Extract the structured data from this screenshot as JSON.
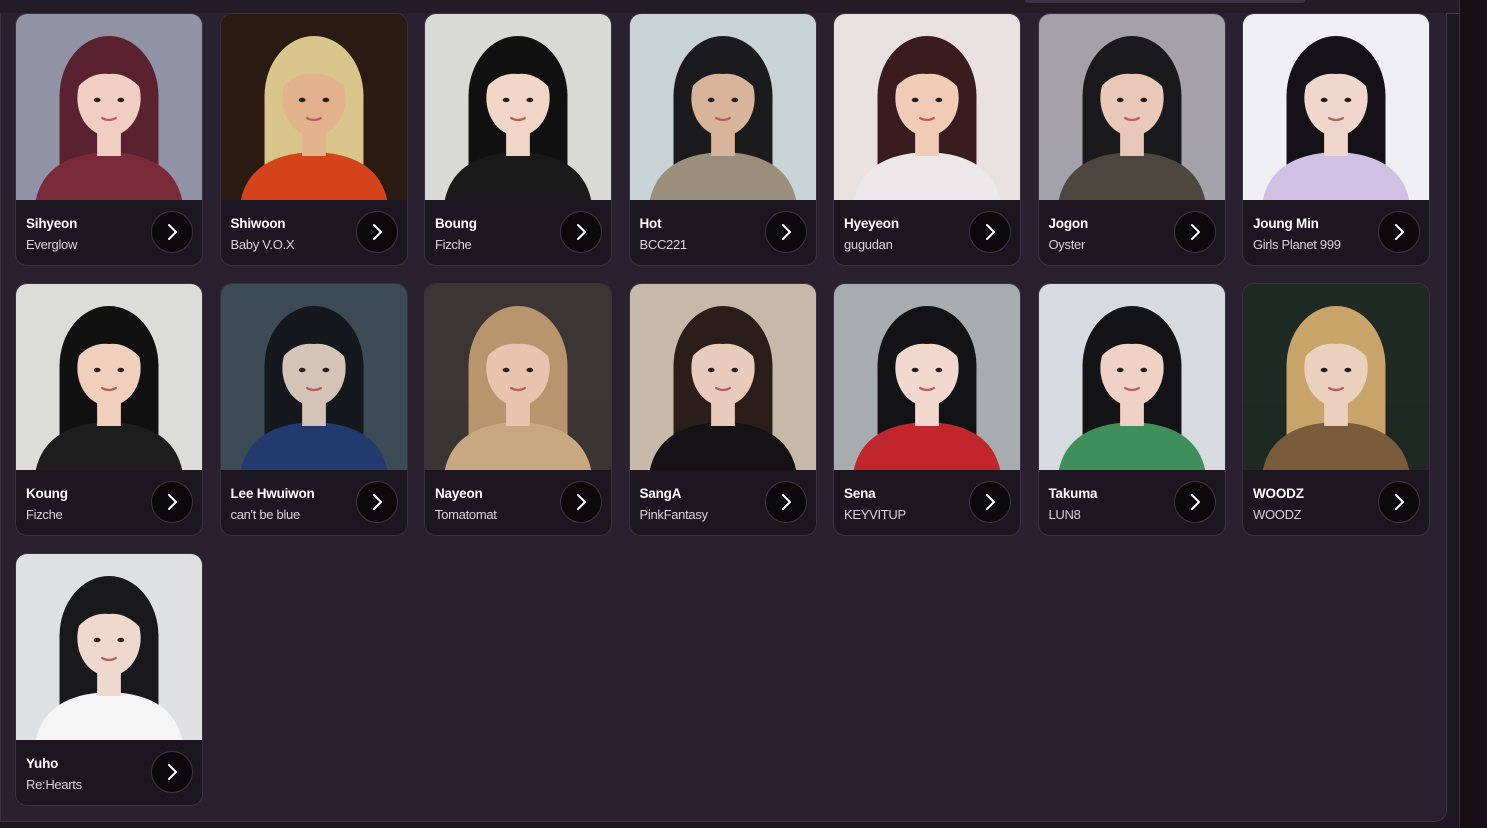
{
  "artists": [
    {
      "name": "Sihyeon",
      "group": "Everglow",
      "photo": {
        "bg": "#8f93a5",
        "accent": "#7a2a3a",
        "skin": "#f0cfc2",
        "hair": "#5a2230"
      }
    },
    {
      "name": "Shiwoon",
      "group": "Baby V.O.X",
      "photo": {
        "bg": "#2a1a12",
        "accent": "#d4431a",
        "skin": "#e1b28c",
        "hair": "#d9c48a"
      }
    },
    {
      "name": "Boung",
      "group": "Fizche",
      "photo": {
        "bg": "#d9d9d6",
        "accent": "#1a1a1a",
        "skin": "#f1d5c6",
        "hair": "#111111"
      }
    },
    {
      "name": "Hot",
      "group": "BCC221",
      "photo": {
        "bg": "#c9d3d6",
        "accent": "#9a8f7d",
        "skin": "#d8b49a",
        "hair": "#1b1b1d"
      }
    },
    {
      "name": "Hyeyeon",
      "group": "gugudan",
      "photo": {
        "bg": "#e8e1e0",
        "accent": "#ece8ea",
        "skin": "#f0cbb6",
        "hair": "#3a1b1e"
      }
    },
    {
      "name": "Jogon",
      "group": "Oyster",
      "photo": {
        "bg": "#a4a2a8",
        "accent": "#4e473f",
        "skin": "#e9c8b7",
        "hair": "#1a1a1c"
      }
    },
    {
      "name": "Joung Min",
      "group": "Girls Planet 999",
      "photo": {
        "bg": "#efeef2",
        "accent": "#cfc0e4",
        "skin": "#f1d7cb",
        "hair": "#151217"
      }
    },
    {
      "name": "Koung",
      "group": "Fizche",
      "photo": {
        "bg": "#dcdcd8",
        "accent": "#1e1e1e",
        "skin": "#f0cfbd",
        "hair": "#111111"
      }
    },
    {
      "name": "Lee Hwuiwon",
      "group": "can't be blue",
      "photo": {
        "bg": "#3c4b55",
        "accent": "#223a6e",
        "skin": "#d6c3b8",
        "hair": "#15181c"
      }
    },
    {
      "name": "Nayeon",
      "group": "Tomatomat",
      "photo": {
        "bg": "#3b3633",
        "accent": "#c8a880",
        "skin": "#e9c3ad",
        "hair": "#b8956d"
      }
    },
    {
      "name": "SangA",
      "group": "PinkFantasy",
      "photo": {
        "bg": "#c7b9aa",
        "accent": "#141214",
        "skin": "#e9cbbb",
        "hair": "#2a1d1a"
      }
    },
    {
      "name": "Sena",
      "group": "KEYVITUP",
      "photo": {
        "bg": "#a7acb0",
        "accent": "#c0262b",
        "skin": "#f2d8cf",
        "hair": "#131316"
      }
    },
    {
      "name": "Takuma",
      "group": "LUN8",
      "photo": {
        "bg": "#d7dbe0",
        "accent": "#3e8f5a",
        "skin": "#efd2c5",
        "hair": "#141417"
      }
    },
    {
      "name": "WOODZ",
      "group": "WOODZ",
      "photo": {
        "bg": "#1f2a24",
        "accent": "#7a5b3c",
        "skin": "#ead0bd",
        "hair": "#c9a46a"
      }
    },
    {
      "name": "Yuho",
      "group": "Re:Hearts",
      "photo": {
        "bg": "#dfe0e2",
        "accent": "#f5f5f5",
        "skin": "#efd9cf",
        "hair": "#19191c"
      }
    }
  ]
}
